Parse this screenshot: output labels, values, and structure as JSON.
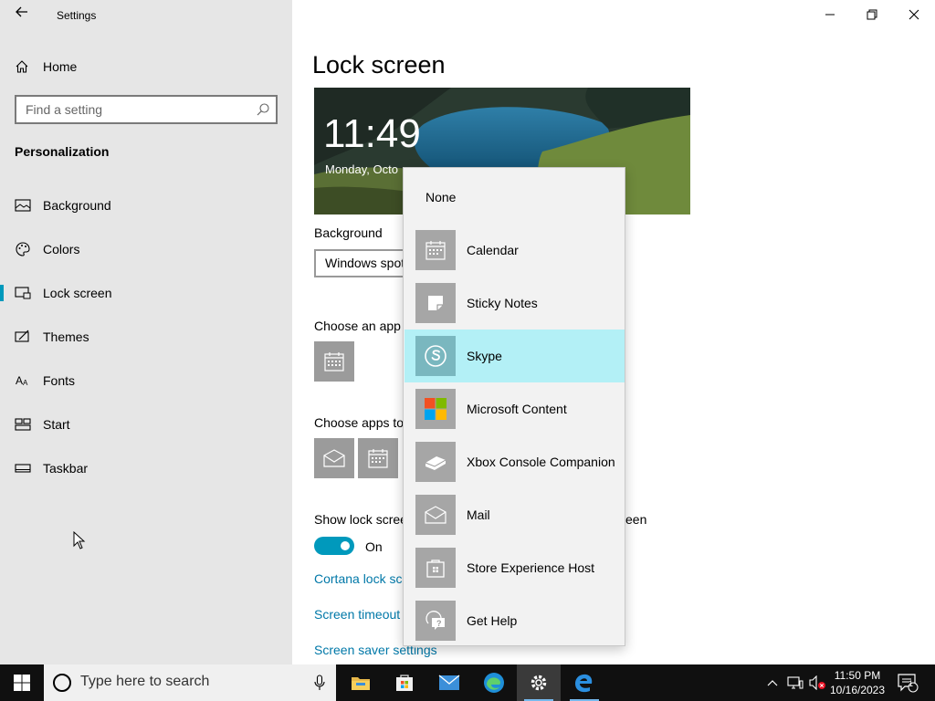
{
  "window": {
    "title": "Settings"
  },
  "sidebar": {
    "home_label": "Home",
    "search_placeholder": "Find a setting",
    "section_title": "Personalization",
    "items": [
      {
        "label": "Background",
        "icon": "picture-icon"
      },
      {
        "label": "Colors",
        "icon": "palette-icon"
      },
      {
        "label": "Lock screen",
        "icon": "lock-screen-icon",
        "active": true
      },
      {
        "label": "Themes",
        "icon": "themes-icon"
      },
      {
        "label": "Fonts",
        "icon": "fonts-icon"
      },
      {
        "label": "Start",
        "icon": "start-icon"
      },
      {
        "label": "Taskbar",
        "icon": "taskbar-icon"
      }
    ]
  },
  "main": {
    "title": "Lock screen",
    "preview": {
      "time": "11:49",
      "date": "Monday, Octo"
    },
    "background_label": "Background",
    "background_value": "Windows spotlight",
    "choose_app_label": "Choose an app",
    "choose_apps_label": "Choose apps to",
    "show_lock_label": "Show lock scree",
    "show_lock_label_end": "een",
    "toggle_state": "On",
    "links": {
      "cortana": "Cortana lock scr",
      "timeout": "Screen timeout",
      "saver": "Screen saver settings"
    }
  },
  "dropdown": {
    "none_label": "None",
    "items": [
      {
        "label": "Calendar",
        "icon": "calendar-icon"
      },
      {
        "label": "Sticky Notes",
        "icon": "sticky-notes-icon"
      },
      {
        "label": "Skype",
        "icon": "skype-icon",
        "selected": true
      },
      {
        "label": "Microsoft Content",
        "icon": "microsoft-logo-icon"
      },
      {
        "label": "Xbox Console Companion",
        "icon": "xbox-console-icon"
      },
      {
        "label": "Mail",
        "icon": "mail-icon"
      },
      {
        "label": "Store Experience Host",
        "icon": "store-icon"
      },
      {
        "label": "Get Help",
        "icon": "get-help-icon"
      }
    ]
  },
  "taskbar": {
    "search_placeholder": "Type here to search",
    "time": "11:50 PM",
    "date": "10/16/2023",
    "notification_count": "1"
  },
  "colors": {
    "accent": "#0099bc",
    "selection": "#b3f0f6",
    "link": "#0078a8"
  }
}
